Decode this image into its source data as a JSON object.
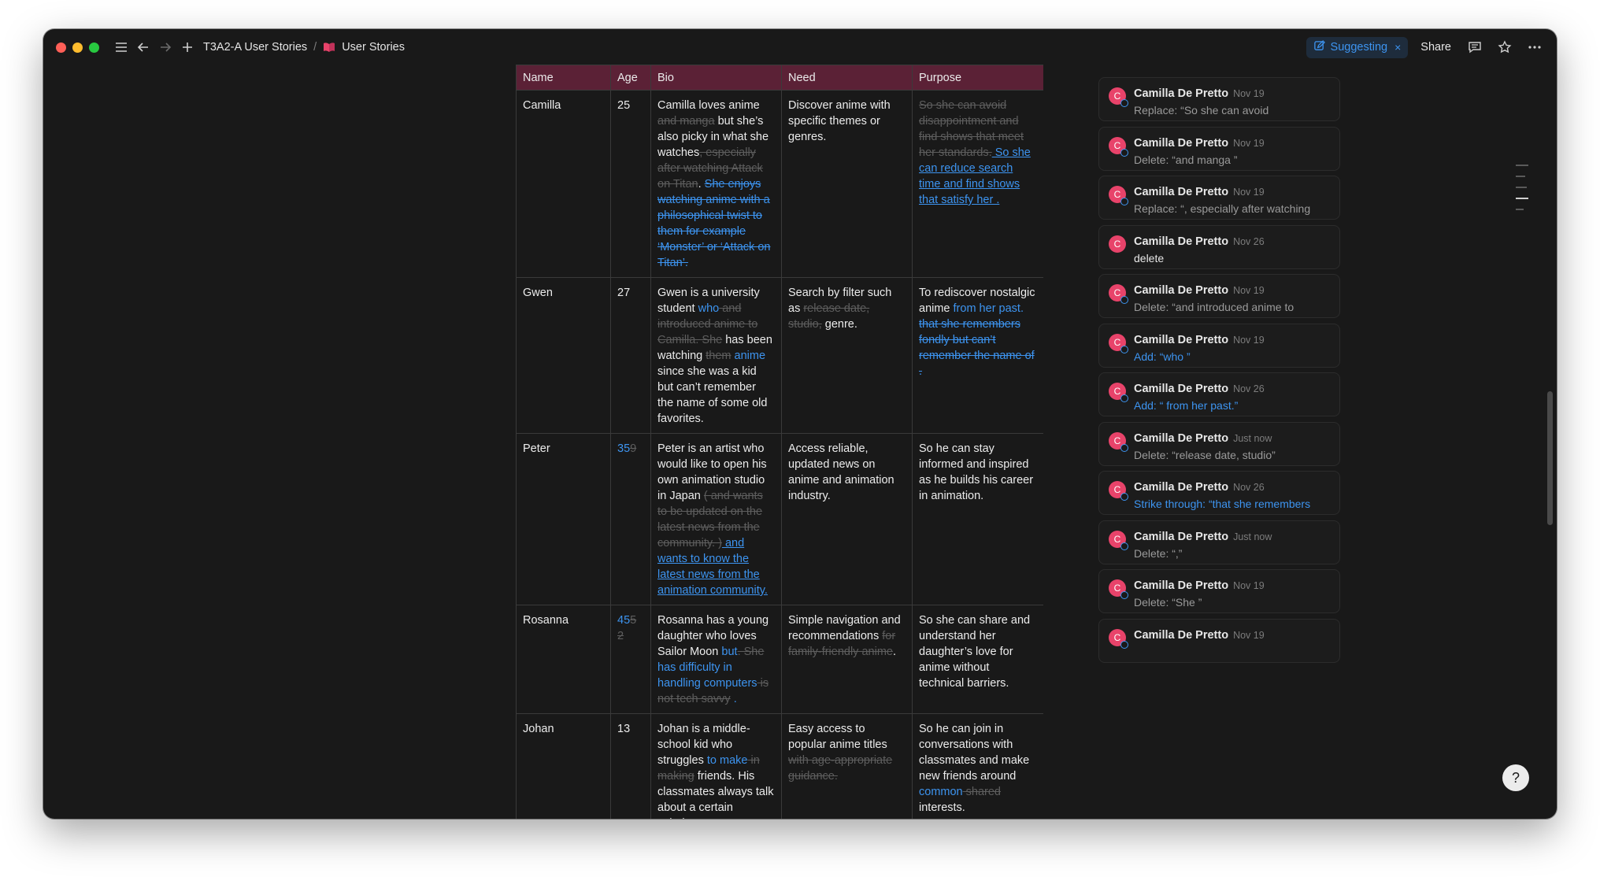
{
  "breadcrumb": {
    "parent": "T3A2-A User Stories",
    "separator": "/",
    "current": "User Stories"
  },
  "topbar": {
    "mode_label": "Suggesting",
    "mode_close": "×",
    "share_label": "Share"
  },
  "table": {
    "headers": [
      "Name",
      "Age",
      "Bio",
      "Need",
      "Purpose"
    ],
    "rows": [
      {
        "name": "Camilla",
        "age": "25"
      },
      {
        "name": "Gwen",
        "age": "27"
      },
      {
        "name": "Peter"
      },
      {
        "name": "Rosanna"
      },
      {
        "name": "Johan",
        "age": "13"
      }
    ],
    "camilla": {
      "bio": [
        {
          "t": "Camilla loves anime ",
          "k": "plain"
        },
        {
          "t": "and manga",
          "k": "del"
        },
        {
          "t": " but she’s also picky in what she watches",
          "k": "plain"
        },
        {
          "t": ", especially after watching Attack on Titan",
          "k": "del"
        },
        {
          "t": ". ",
          "k": "plain"
        },
        {
          "t": "She enjoys watching anime with a philosophical twist to them for example ‘Monster’ or ‘Attack on Titan’.",
          "k": "insdel"
        }
      ],
      "need": "Discover anime with specific themes or genres.",
      "purpose": [
        {
          "t": "So she can avoid disappointment and find shows that meet her standards.",
          "k": "del"
        },
        {
          "t": " So she can reduce search time and find shows that satisfy her .",
          "k": "u-ins"
        }
      ]
    },
    "gwen": {
      "bio": [
        {
          "t": "Gwen is a university student ",
          "k": "plain"
        },
        {
          "t": "who",
          "k": "ins"
        },
        {
          "t": " and introduced anime to Camilla. She",
          "k": "del"
        },
        {
          "t": " has been watching ",
          "k": "plain"
        },
        {
          "t": "them",
          "k": "del"
        },
        {
          "t": " anime",
          "k": "ins"
        },
        {
          "t": " since she was a kid but can’t remember the name of some old favorites.",
          "k": "plain"
        }
      ],
      "need": [
        {
          "t": "Search by filter such as ",
          "k": "plain"
        },
        {
          "t": "release date, studio,",
          "k": "del"
        },
        {
          "t": " genre.",
          "k": "plain"
        }
      ],
      "purpose": [
        {
          "t": "To rediscover nostalgic anime ",
          "k": "plain"
        },
        {
          "t": "from her past.",
          "k": "ins"
        },
        {
          "t": " that she remembers fondly but can’t remember the name of . ",
          "k": "insdel"
        }
      ]
    },
    "peter": {
      "age": [
        {
          "t": "35",
          "k": "ins"
        },
        {
          "t": "9",
          "k": "del"
        }
      ],
      "bio": [
        {
          "t": "Peter is an artist who would like to open his own animation studio in Japan ",
          "k": "plain"
        },
        {
          "t": "( and wants to be updated on the latest news from the community. )",
          "k": "del"
        },
        {
          "t": " and wants to know the latest news from the animation community.",
          "k": "u-ins"
        }
      ],
      "need": "Access reliable, updated news on anime and animation industry.",
      "purpose": "So he can stay informed and inspired as he builds his career in animation."
    },
    "rosanna": {
      "age": [
        {
          "t": "45",
          "k": "ins"
        },
        {
          "t": "5 2",
          "k": "del"
        }
      ],
      "bio": [
        {
          "t": "Rosanna has a young daughter who loves Sailor Moon ",
          "k": "plain"
        },
        {
          "t": "but",
          "k": "ins"
        },
        {
          "t": ". She",
          "k": "del"
        },
        {
          "t": " has difficulty in handling computers",
          "k": "ins"
        },
        {
          "t": " is not tech savvy",
          "k": "del"
        },
        {
          "t": " .",
          "k": "ins"
        }
      ],
      "need": [
        {
          "t": "Simple navigation and recommendations ",
          "k": "plain"
        },
        {
          "t": "for family-friendly anime",
          "k": "del"
        },
        {
          "t": ".",
          "k": "plain"
        }
      ],
      "purpose": "So she can share and understand her daughter’s love for anime without technical barriers."
    },
    "johan": {
      "bio": [
        {
          "t": "Johan is a middle-school kid who struggles ",
          "k": "plain"
        },
        {
          "t": "to make",
          "k": "ins"
        },
        {
          "t": " in making",
          "k": "del"
        },
        {
          "t": " friends. His classmates always talk about a certain “Chainsaw Man”",
          "k": "plain"
        }
      ],
      "need": [
        {
          "t": "Easy access to popular anime titles ",
          "k": "plain"
        },
        {
          "t": "with age-appropriate guidance.",
          "k": "del"
        }
      ],
      "purpose": [
        {
          "t": "So he can join in conversations with classmates and make new friends around ",
          "k": "plain"
        },
        {
          "t": "common",
          "k": "ins"
        },
        {
          "t": " shared",
          "k": "del"
        },
        {
          "t": " interests.",
          "k": "plain"
        }
      ]
    }
  },
  "comments": [
    {
      "author": "Camilla De Pretto",
      "time": "Nov 19",
      "label": "Replace: ",
      "text": "“So she can avoid",
      "style": "lbl"
    },
    {
      "author": "Camilla De Pretto",
      "time": "Nov 19",
      "label": "Delete: ",
      "text": "“and manga ”",
      "style": "lbl"
    },
    {
      "author": "Camilla De Pretto",
      "time": "Nov 19",
      "label": "Replace: ",
      "text": "“, especially after watching",
      "style": "lbl"
    },
    {
      "author": "Camilla De Pretto",
      "time": "Nov 26",
      "label": "",
      "text": "delete",
      "style": "plain"
    },
    {
      "author": "Camilla De Pretto",
      "time": "Nov 19",
      "label": "Delete: ",
      "text": "“and introduced anime to",
      "style": "lbl"
    },
    {
      "author": "Camilla De Pretto",
      "time": "Nov 19",
      "label": "Add: ",
      "text": "“who ”",
      "style": "blue"
    },
    {
      "author": "Camilla De Pretto",
      "time": "Nov 26",
      "label": "Add: ",
      "text": "“ from her past.”",
      "style": "blue"
    },
    {
      "author": "Camilla De Pretto",
      "time": "Just now",
      "label": "Delete: ",
      "text": "“release date, studio”",
      "style": "lbl"
    },
    {
      "author": "Camilla De Pretto",
      "time": "Nov 26",
      "label": "Strike through: ",
      "text": "“that she remembers",
      "style": "blue"
    },
    {
      "author": "Camilla De Pretto",
      "time": "Just now",
      "label": "Delete: ",
      "text": "“,”",
      "style": "lbl"
    },
    {
      "author": "Camilla De Pretto",
      "time": "Nov 19",
      "label": "Delete: ",
      "text": "“She ”",
      "style": "lbl"
    },
    {
      "author": "Camilla De Pretto",
      "time": "Nov 19",
      "label": "",
      "text": "",
      "style": "lbl"
    }
  ],
  "avatar_letter": "C",
  "help_glyph": "?",
  "colors": {
    "accent": "#3d94f0",
    "header_bg": "#5b2136",
    "avatar": "#e8436a",
    "window_bg": "#191919"
  },
  "icons": [
    "menu-icon",
    "back-arrow-icon",
    "forward-arrow-icon",
    "add-icon",
    "book-icon",
    "suggest-edit-icon",
    "comment-icon",
    "star-icon",
    "more-icon",
    "help-icon"
  ]
}
